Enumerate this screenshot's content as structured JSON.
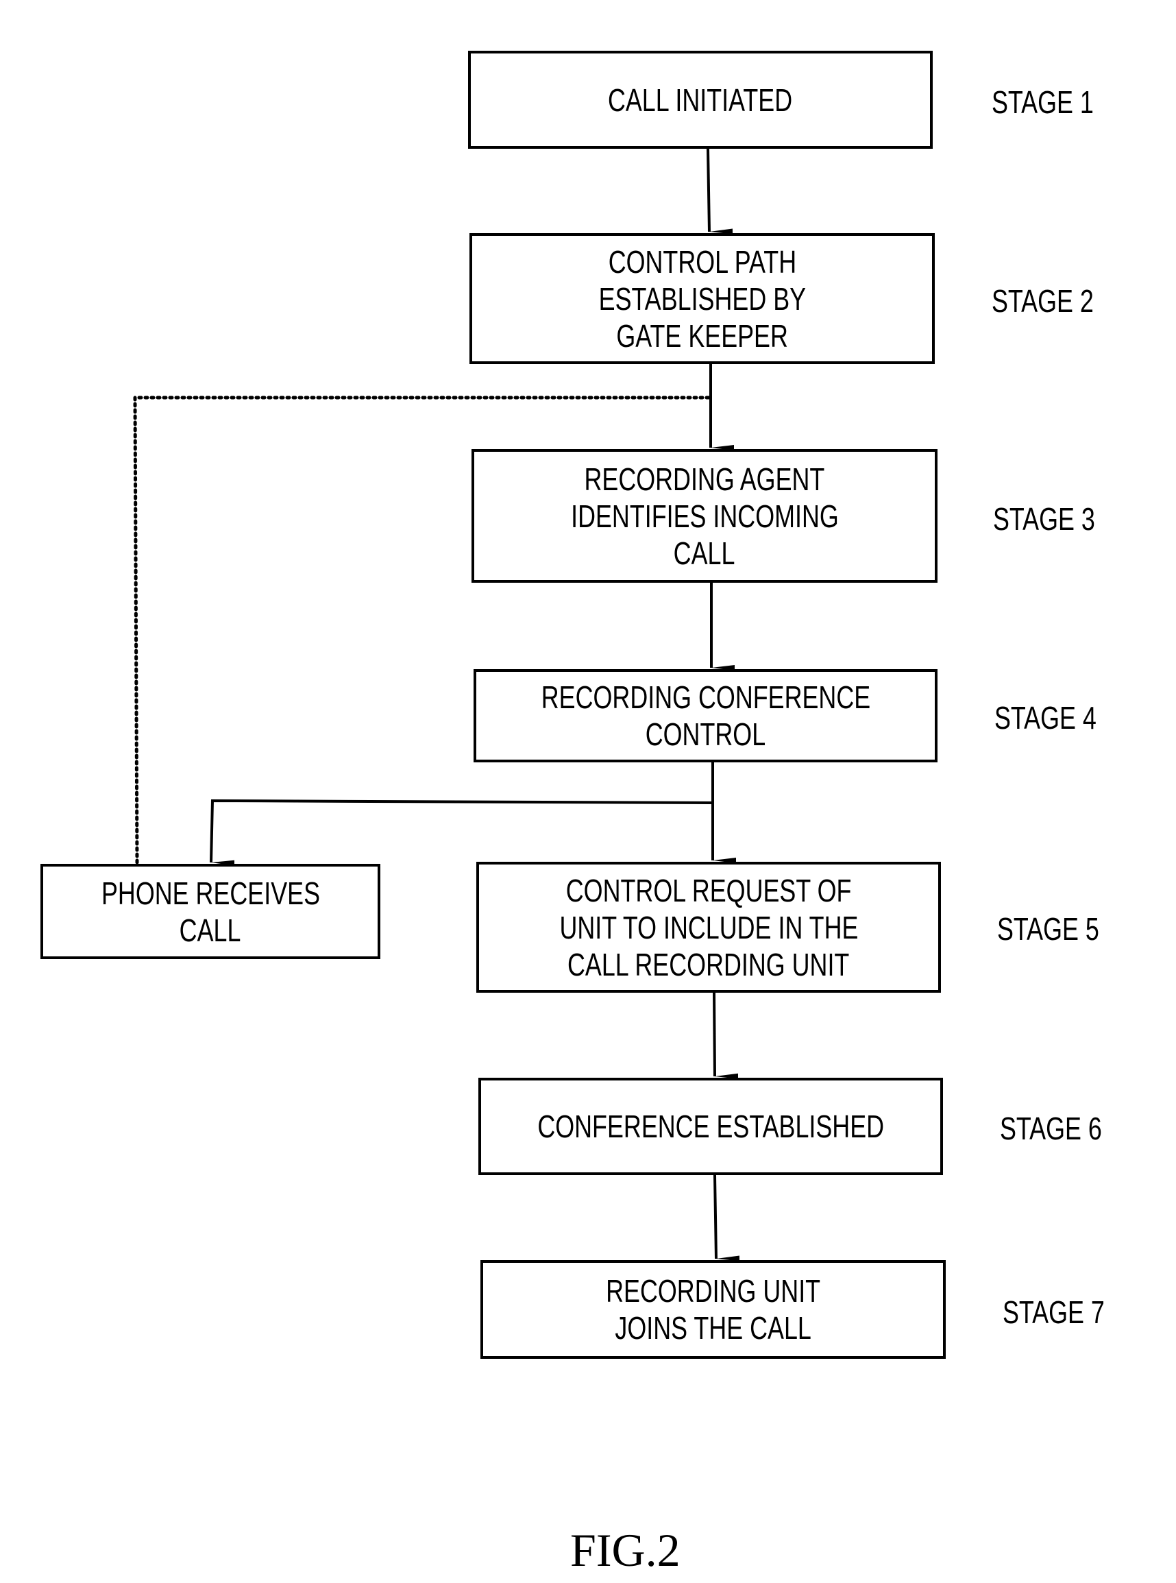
{
  "figure_label": "FIG.2",
  "boxes": {
    "call_initiated": {
      "lines": [
        "CALL INITIATED"
      ]
    },
    "control_path": {
      "lines": [
        "CONTROL PATH",
        "ESTABLISHED BY",
        "GATE KEEPER"
      ]
    },
    "recording_agent": {
      "lines": [
        "RECORDING AGENT",
        "IDENTIFIES INCOMING",
        "CALL"
      ]
    },
    "conference_control": {
      "lines": [
        "RECORDING CONFERENCE",
        "CONTROL"
      ]
    },
    "phone_receives": {
      "lines": [
        "PHONE RECEIVES",
        "CALL"
      ]
    },
    "control_request": {
      "lines": [
        "CONTROL REQUEST OF",
        "UNIT TO INCLUDE IN THE",
        "CALL RECORDING UNIT"
      ]
    },
    "conference_established": {
      "lines": [
        "CONFERENCE ESTABLISHED"
      ]
    },
    "recording_unit_joins": {
      "lines": [
        "RECORDING UNIT",
        "JOINS THE CALL"
      ]
    }
  },
  "stages": [
    "STAGE 1",
    "STAGE 2",
    "STAGE 3",
    "STAGE 4",
    "STAGE 5",
    "STAGE 6",
    "STAGE 7"
  ],
  "connections": [
    {
      "from": "call_initiated",
      "to": "control_path",
      "style": "solid",
      "arrow": true
    },
    {
      "from": "control_path",
      "to": "recording_agent",
      "style": "solid",
      "arrow": true
    },
    {
      "from": "recording_agent",
      "to": "conference_control",
      "style": "solid",
      "arrow": true
    },
    {
      "from": "conference_control",
      "to": "control_request",
      "style": "solid",
      "arrow": true
    },
    {
      "from": "conference_control",
      "to": "phone_receives",
      "style": "solid",
      "arrow": true
    },
    {
      "from": "phone_receives",
      "to": "control_path",
      "style": "dotted",
      "arrow": false
    },
    {
      "from": "control_request",
      "to": "conference_established",
      "style": "solid",
      "arrow": true
    },
    {
      "from": "conference_established",
      "to": "recording_unit_joins",
      "style": "solid",
      "arrow": true
    }
  ]
}
